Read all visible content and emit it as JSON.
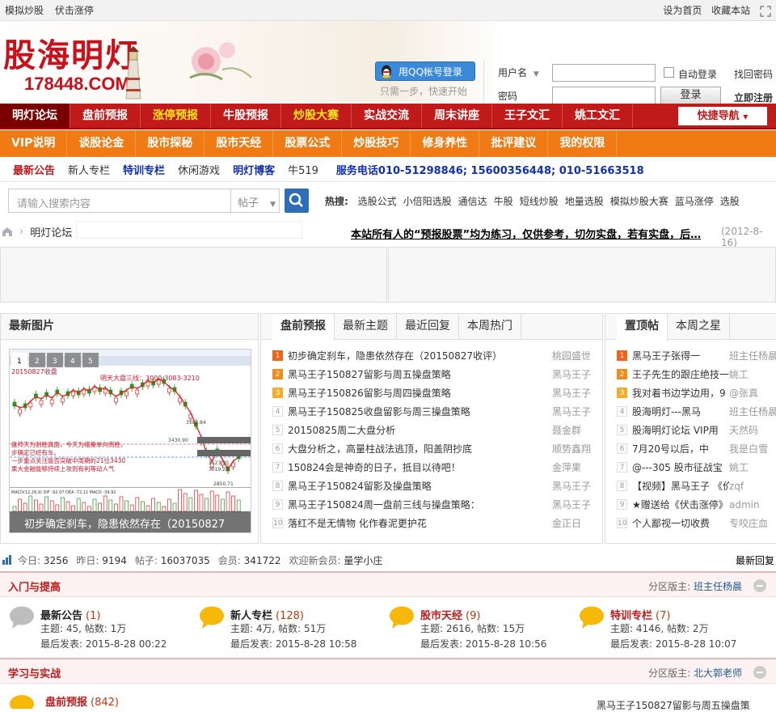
{
  "topbar": {
    "left": [
      "模拟炒股",
      "伏击涨停"
    ],
    "right": [
      "设为首页",
      "收藏本站"
    ]
  },
  "header": {
    "logo_text": "股海明灯",
    "logo_url": "178448.COM",
    "qq_login": "用QQ帐号登录",
    "qq_hint": "只需一步，快速开始",
    "username_label": "用户名",
    "password_label": "密码",
    "auto_login": "自动登录",
    "find_password": "找回密码",
    "login_button": "登录",
    "register": "立即注册"
  },
  "nav_primary": [
    {
      "label": "明灯论坛",
      "style": "cur"
    },
    {
      "label": "盘前预报",
      "style": ""
    },
    {
      "label": "涨停预报",
      "style": "yel"
    },
    {
      "label": "牛股预报",
      "style": ""
    },
    {
      "label": "炒股大赛",
      "style": "yel"
    },
    {
      "label": "实战交流",
      "style": ""
    },
    {
      "label": "周末讲座",
      "style": ""
    },
    {
      "label": "王子文汇",
      "style": ""
    },
    {
      "label": "姚工文汇",
      "style": ""
    }
  ],
  "quick_nav": "快捷导航",
  "nav_secondary": [
    "VIP说明",
    "谈股论金",
    "股市探秘",
    "股市天经",
    "股票公式",
    "炒股技巧",
    "修身养性",
    "批评建议",
    "我的权限"
  ],
  "nav_tertiary": [
    {
      "label": "最新公告",
      "style": "red"
    },
    {
      "label": "新人专栏",
      "style": ""
    },
    {
      "label": "特训专栏",
      "style": "blue"
    },
    {
      "label": "休闲游戏",
      "style": ""
    },
    {
      "label": "明灯博客",
      "style": "blue"
    },
    {
      "label": "牛519",
      "style": ""
    },
    {
      "label": "服务电话010-51298846; 15600356448; 010-51663518",
      "style": "blue"
    }
  ],
  "search": {
    "placeholder": "请输入搜索内容",
    "type": "帖子",
    "hot_label": "热搜:",
    "hot_items": [
      "选股公式",
      "小倍阳选股",
      "通信达",
      "牛股",
      "短线炒股",
      "地量选股",
      "模拟炒股大赛",
      "蓝马涨停",
      "选股"
    ]
  },
  "breadcrumb": {
    "current": "明灯论坛"
  },
  "notice": {
    "text": "本站所有人的“预报股票”均为练习，仅供参考，切勿实盘，若有实盘，后…",
    "date": "(2012-8-16)"
  },
  "latest_images": {
    "title": "最新图片",
    "pages": [
      "1",
      "2",
      "3",
      "4",
      "5"
    ],
    "caption": "初步确定刹车，隐患依然存在（20150827",
    "chart_labels": {
      "date": "20150827收盘",
      "line": "明天大盘三线：3000-3083-3210",
      "n1": "3582.84",
      "n2": "3430.90",
      "n3": "3123.00",
      "n4": "3019.25",
      "n5": "2850.71",
      "note1": "盘师天为割胜真面，今天为缩量单向而胜，",
      "note2": "步确定已经有车。",
      "note3": "一步重点关注能否突破中周期的21位3430",
      "note4": "果大金融能够持续上攻则有利等动人气",
      "macd": "MACD(12,26,9)  DIF -92.07  DEA -72.11  MACD -39.92"
    }
  },
  "center_panel": {
    "tabs": [
      "盘前预报",
      "最新主题",
      "最近回复",
      "本周热门"
    ],
    "rows": [
      {
        "num": "1",
        "title": "初步确定刹车，隐患依然存在（20150827收评）",
        "author": "桃园盛世"
      },
      {
        "num": "2",
        "title": "黑马王子150827留影与周五操盘策略",
        "author": "黑马王子"
      },
      {
        "num": "3",
        "title": "黑马王子150826留影与周四操盘策略",
        "author": "黑马王子"
      },
      {
        "num": "4",
        "title": "黑马王子150825收盘留影与周三操盘策略",
        "author": "黑马王子"
      },
      {
        "num": "5",
        "title": "20150825周二大盘分析",
        "author": "聂金群"
      },
      {
        "num": "6",
        "title": "大盘分析之，高量柱战法逃顶，阳盖阴抄底",
        "author": "顺势鑫翔"
      },
      {
        "num": "7",
        "title": "150824会是神奇的日子，抵目以待吧！",
        "author": "金萍果"
      },
      {
        "num": "8",
        "title": "黑马王子150824留影及操盘策略",
        "author": "黑马王子"
      },
      {
        "num": "9",
        "title": "黑马王子150824周一盘前三线与操盘策略：",
        "author": "黑马王子"
      },
      {
        "num": "10",
        "title": "落红不是无情物 化作春泥更护花",
        "author": "金正日"
      }
    ]
  },
  "right_panel": {
    "tabs": [
      "置顶帖",
      "本周之星"
    ],
    "rows": [
      {
        "num": "1",
        "title": "黑马王子张得一",
        "author": "班主任杨晨"
      },
      {
        "num": "2",
        "title": "王子先生的跟庄绝技一",
        "author": "姚工"
      },
      {
        "num": "3",
        "title": "我对着书边学边用，9",
        "author": "@张真"
      },
      {
        "num": "4",
        "title": "股海明灯---黑马",
        "author": "班主任杨晨"
      },
      {
        "num": "5",
        "title": "股海明灯论坛 VIP用",
        "author": "天然码"
      },
      {
        "num": "6",
        "title": "7月20号以后，中",
        "author": "我是白雪"
      },
      {
        "num": "7",
        "title": "@---305 股市征战宝",
        "author": "姚工"
      },
      {
        "num": "8",
        "title": "【视频】黑马王子 《价升",
        "author": "zqf"
      },
      {
        "num": "9",
        "title": "★赠送给《伏击涨停》",
        "author": "admin"
      },
      {
        "num": "10",
        "title": "个人鄙视一切收费",
        "author": "专咬庄血"
      }
    ]
  },
  "stats": {
    "today_label": "今日:",
    "today": "3256",
    "yesterday_label": "昨日:",
    "yesterday": "9194",
    "posts_label": "帖子:",
    "posts": "16037035",
    "members_label": "会员:",
    "members": "341722",
    "welcome_label": "欢迎新会员:",
    "new_member": "量学小庄",
    "latest_reply": "最新回复"
  },
  "sections": [
    {
      "title": "入门与提高",
      "moderator_label": "分区版主:",
      "moderator": "班主任杨晨",
      "forums": [
        {
          "name": "最新公告",
          "count": "(1)",
          "color": "#222",
          "stats": "主题: 45, 帖数: 1万",
          "last": "最后发表: 2015-8-28 00:22",
          "icon": "gray"
        },
        {
          "name": "新人专栏",
          "count": "(128)",
          "color": "#222",
          "stats": "主题: 4万, 帖数: 51万",
          "last": "最后发表: 2015-8-28 10:58",
          "icon": "yellow"
        },
        {
          "name": "股市天经",
          "count": "(9)",
          "color": "#c01a1a",
          "stats": "主题: 2616, 帖数: 15万",
          "last": "最后发表: 2015-8-28 10:56",
          "icon": "yellow"
        },
        {
          "name": "特训专栏",
          "count": "(7)",
          "color": "#c01a1a",
          "stats": "主题: 4146, 帖数: 2万",
          "last": "最后发表: 2015-8-28 10:07",
          "icon": "yellow"
        }
      ]
    },
    {
      "title": "学习与实战",
      "moderator_label": "分区版主:",
      "moderator": "北大郭老师",
      "forum_name": "盘前预报",
      "forum_count": "(842)",
      "forum_last": "黑马王子150827留影与周五操盘策"
    }
  ],
  "colors": {
    "nav_red": "#c01a1a",
    "nav_orange": "#f07a13",
    "link_blue": "#1030b8"
  }
}
